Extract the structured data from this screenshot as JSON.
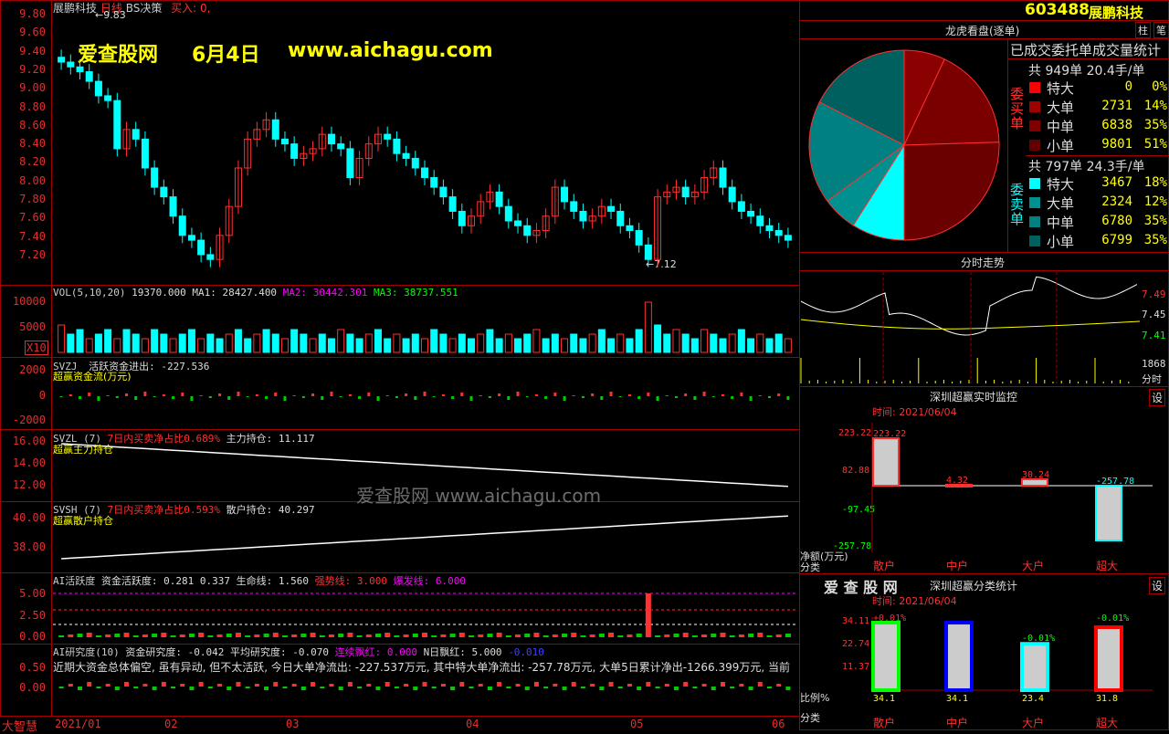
{
  "header": {
    "stock_name": "展鹏科技",
    "period": "日线",
    "indicator": "BS决策",
    "buy_label": "买入: 0,",
    "high_mark": "←9.83",
    "low_mark": "←7.12"
  },
  "watermark": {
    "site": "爱查股网",
    "date": "6月4日",
    "url": "www.aichagu.com",
    "mid": "爱查股网    www.aichagu.com"
  },
  "price_axis": [
    "9.80",
    "9.60",
    "9.40",
    "9.20",
    "9.00",
    "8.80",
    "8.60",
    "8.40",
    "8.20",
    "8.00",
    "7.80",
    "7.60",
    "7.40",
    "7.20"
  ],
  "vol": {
    "header": "VOL(5,10,20)",
    "value": "19370.000",
    "ma1": "MA1: 28427.400",
    "ma2": "MA2: 30442.301",
    "ma3": "MA3: 38737.551",
    "axis": [
      "10000",
      "5000"
    ],
    "unit": "X10"
  },
  "svzj": {
    "header": "SVZJ",
    "title": "活跃资金进出: -227.536",
    "sub": "超赢资金流(万元)",
    "axis": [
      "2000",
      "0",
      "-2000"
    ]
  },
  "svzl": {
    "header": "SVZL (7)",
    "ratio": "7日内买卖净占比0.689%",
    "hold": "主力持仓: 11.117",
    "sub": "超赢主力持仓",
    "axis": [
      "16.00",
      "14.00",
      "12.00"
    ]
  },
  "svsh": {
    "header": "SVSH (7)",
    "ratio": "7日内买卖净占比0.593%",
    "hold": "散户持仓: 40.297",
    "sub": "超赢散户持仓",
    "axis": [
      "40.00",
      "38.00"
    ]
  },
  "ai_act": {
    "header": "AI活跃度",
    "l1": "资金活跃度: 0.281",
    "l2": "0.337",
    "l3": "生命线: 1.560",
    "l4": "强势线: 3.000",
    "l5": "爆发线: 6.000",
    "axis": [
      "5.00",
      "2.50",
      "0.00"
    ]
  },
  "ai_res": {
    "header": "AI研究度(10)",
    "l1": "资金研究度: -0.042",
    "l2": "平均研究度: -0.070",
    "l3": "连续飘红: 0.000",
    "l4": "N日飘红: 5.000",
    "l5": "-0.010",
    "desc": "近期大资金总体偏空, 虽有异动, 但不太活跃, 今日大单净流出: -227.537万元, 其中特大单净流出: -257.78万元, 大单5日累计净出-1266.399万元, 当前",
    "axis": [
      "0.50",
      "0.00"
    ]
  },
  "bottom": {
    "brand": "大智慧",
    "dates": [
      "2021/01",
      "02",
      "03",
      "04",
      "05",
      "06"
    ]
  },
  "right": {
    "code": "603488",
    "name": "展鹏科技",
    "btn1": "柱",
    "btn2": "笔",
    "pie_title": "龙虎看盘(逐单)",
    "stats_title": "已成交委托单成交量统计",
    "buy": {
      "side": "委买单",
      "total": "共 949单 20.4手/单",
      "rows": [
        {
          "name": "特大",
          "count": "0",
          "pct": "0%",
          "color": "#ff0000"
        },
        {
          "name": "大单",
          "count": "2731",
          "pct": "14%",
          "color": "#a00000"
        },
        {
          "name": "中单",
          "count": "6838",
          "pct": "35%",
          "color": "#800000"
        },
        {
          "name": "小单",
          "count": "9801",
          "pct": "51%",
          "color": "#600000"
        }
      ]
    },
    "sell": {
      "side": "委卖单",
      "total": "共 797单 24.3手/单",
      "rows": [
        {
          "name": "特大",
          "count": "3467",
          "pct": "18%",
          "color": "#00ffff"
        },
        {
          "name": "大单",
          "count": "2324",
          "pct": "12%",
          "color": "#009090"
        },
        {
          "name": "中单",
          "count": "6780",
          "pct": "35%",
          "color": "#008080"
        },
        {
          "name": "小单",
          "count": "6799",
          "pct": "35%",
          "color": "#006060"
        }
      ]
    },
    "intraday": {
      "title": "分时走势",
      "axis": [
        "7.49",
        "7.45",
        "7.41"
      ],
      "vol_label": "1868",
      "vol_unit": "分时"
    },
    "monitor": {
      "title": "深圳超赢实时监控",
      "time": "时间: 2021/06/04",
      "axis": [
        "223.22",
        "82.88",
        "-97.45",
        "-257.78"
      ],
      "unit": "净额(万元)",
      "cat_label": "分类",
      "btn": "设",
      "values": [
        {
          "label": "散户",
          "value": "223.22"
        },
        {
          "label": "中户",
          "value": "4.32"
        },
        {
          "label": "大户",
          "value": "30.24"
        },
        {
          "label": "超大",
          "value": "-257.78"
        }
      ]
    },
    "classify": {
      "brand": "爱 查 股 网",
      "title": "深圳超赢分类统计",
      "time": "时间: 2021/06/04",
      "btn": "设",
      "axis": [
        "34.11",
        "22.74",
        "11.37"
      ],
      "ratio_label": "比例%",
      "cat_label": "分类",
      "values": [
        {
          "label": "散户",
          "top": "+0.01%",
          "bottom": "34.1",
          "color": "#00ff00"
        },
        {
          "label": "中户",
          "top": "",
          "bottom": "34.1",
          "color": "#0000ff"
        },
        {
          "label": "大户",
          "top": "-0.01%",
          "bottom": "23.4",
          "color": "#00ffff"
        },
        {
          "label": "超大",
          "top": "-0.01%",
          "bottom": "31.8",
          "color": "#ff0000"
        }
      ]
    }
  },
  "chart_data": {
    "type": "candlestick",
    "title": "展鹏科技 日线",
    "x": [
      "2021/01",
      "02",
      "03",
      "04",
      "05",
      "06"
    ],
    "ylim": [
      7.1,
      9.9
    ],
    "close": [
      9.3,
      9.25,
      9.2,
      9.1,
      8.95,
      8.9,
      8.4,
      8.6,
      8.5,
      8.2,
      8.0,
      7.9,
      7.7,
      7.5,
      7.45,
      7.3,
      7.25,
      7.5,
      7.8,
      8.2,
      8.5,
      8.6,
      8.7,
      8.5,
      8.45,
      8.3,
      8.35,
      8.4,
      8.55,
      8.45,
      8.4,
      8.1,
      8.3,
      8.45,
      8.55,
      8.5,
      8.35,
      8.3,
      8.2,
      8.1,
      8.0,
      7.9,
      7.75,
      7.6,
      7.7,
      7.85,
      7.95,
      7.8,
      7.65,
      7.6,
      7.5,
      7.55,
      7.7,
      8.0,
      7.85,
      7.75,
      7.65,
      7.7,
      7.8,
      7.75,
      7.6,
      7.55,
      7.4,
      7.25,
      7.9,
      7.95,
      8.0,
      7.9,
      7.95,
      8.1,
      8.2,
      8.0,
      7.85,
      7.75,
      7.7,
      7.6,
      7.55,
      7.5,
      7.45
    ]
  }
}
